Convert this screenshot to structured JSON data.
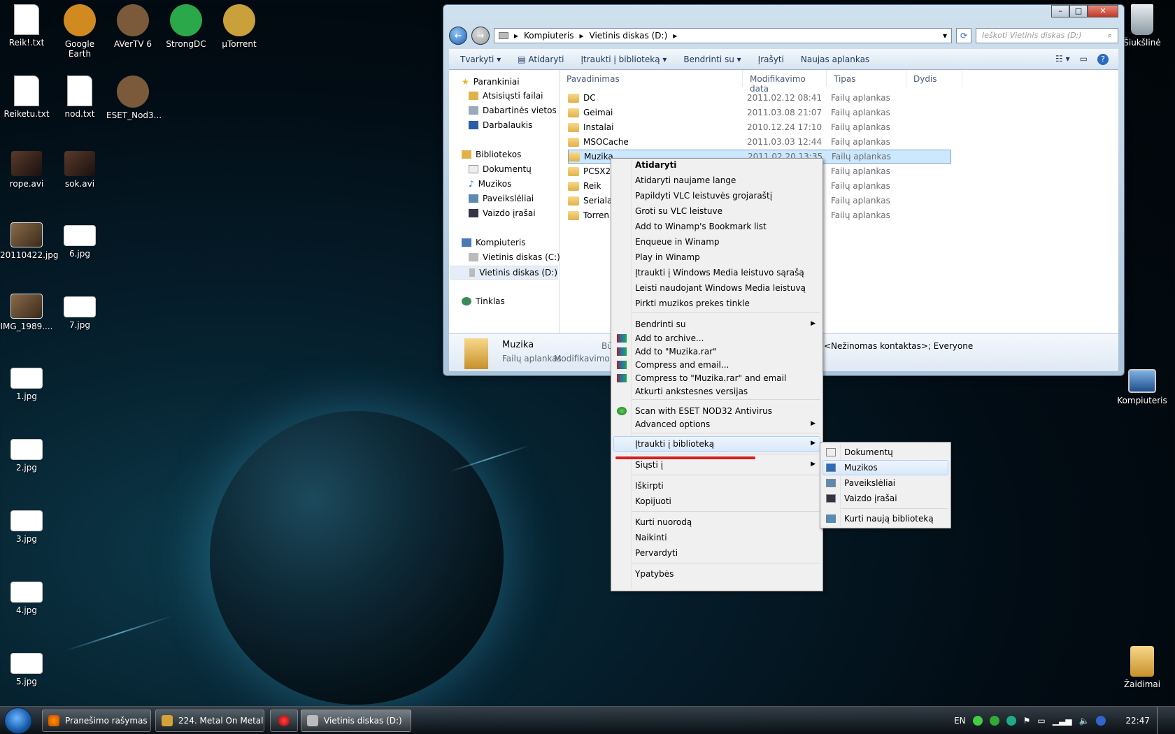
{
  "desktop": {
    "icons": [
      {
        "label": "Reik!.txt",
        "kind": "txt"
      },
      {
        "label": "Google Earth",
        "kind": "app"
      },
      {
        "label": "AVerTV 6",
        "kind": "app"
      },
      {
        "label": "StrongDC",
        "kind": "app"
      },
      {
        "label": "µTorrent",
        "kind": "app"
      },
      {
        "label": "Reiketu.txt",
        "kind": "txt"
      },
      {
        "label": "nod.txt",
        "kind": "txt"
      },
      {
        "label": "ESET_Nod3...",
        "kind": "app"
      },
      {
        "label": "rope.avi",
        "kind": "video"
      },
      {
        "label": "sok.avi",
        "kind": "video"
      },
      {
        "label": "20110422.jpg",
        "kind": "image"
      },
      {
        "label": "6.jpg",
        "kind": "image"
      },
      {
        "label": "IMG_1989....",
        "kind": "image"
      },
      {
        "label": "7.jpg",
        "kind": "image"
      },
      {
        "label": "1.jpg",
        "kind": "image"
      },
      {
        "label": "2.jpg",
        "kind": "image"
      },
      {
        "label": "3.jpg",
        "kind": "image"
      },
      {
        "label": "4.jpg",
        "kind": "image"
      },
      {
        "label": "5.jpg",
        "kind": "image"
      }
    ],
    "right_icons": [
      {
        "label": "Šiukšlinė",
        "icon": "recycle-bin-icon"
      },
      {
        "label": "Kompiuteris",
        "icon": "computer-icon"
      },
      {
        "label": "Žaidimai",
        "icon": "folder-icon"
      }
    ]
  },
  "window": {
    "breadcrumb": [
      "Kompiuteris",
      "Vietinis diskas (D:)"
    ],
    "search_placeholder": "Ieškoti Vietinis diskas (D:)",
    "toolbar": [
      "Tvarkyti",
      "Atidaryti",
      "Įtraukti į biblioteką",
      "Bendrinti su",
      "Įrašyti",
      "Naujas aplankas"
    ],
    "nav": {
      "favorites": "Parankiniai",
      "fav_items": [
        "Atsisiųsti failai",
        "Dabartinės vietos",
        "Darbalaukis"
      ],
      "libraries": "Bibliotekos",
      "lib_items": [
        "Dokumentų",
        "Muzikos",
        "Paveikslėliai",
        "Vaizdo įrašai"
      ],
      "computer": "Kompiuteris",
      "comp_items": [
        "Vietinis diskas (C:)",
        "Vietinis diskas (D:)"
      ],
      "network": "Tinklas"
    },
    "columns": [
      "Pavadinimas",
      "Modifikavimo data",
      "Tipas",
      "Dydis"
    ],
    "files": [
      {
        "name": "DC",
        "date": "2011.02.12 08:41",
        "type": "Failų aplankas"
      },
      {
        "name": "Geimai",
        "date": "2011.03.08 21:07",
        "type": "Failų aplankas"
      },
      {
        "name": "Instalai",
        "date": "2010.12.24 17:10",
        "type": "Failų aplankas"
      },
      {
        "name": "MSOCache",
        "date": "2011.03.03 12:44",
        "type": "Failų aplankas"
      },
      {
        "name": "Muzika",
        "date": "2011.02.20 13:35",
        "type": "Failų aplankas"
      },
      {
        "name": "PCSX2",
        "date": "",
        "type": "Failų aplankas"
      },
      {
        "name": "Reik",
        "date": "",
        "type": "Failų aplankas"
      },
      {
        "name": "Seriala",
        "date": "",
        "type": "Failų aplankas"
      },
      {
        "name": "Torren",
        "date": "",
        "type": "Failų aplankas"
      }
    ],
    "details": {
      "name": "Muzika",
      "type": "Failų aplankas",
      "label2": "Modifikavimo",
      "label1": "Bū",
      "share": "<Nežinomas kontaktas>; Everyone"
    }
  },
  "context_menu": {
    "group1": [
      "Atidaryti",
      "Atidaryti naujame lange",
      "Papildyti VLC leistuvės grojaraštį",
      "Groti su VLC leistuve",
      "Add to Winamp's Bookmark list",
      "Enqueue in Winamp",
      "Play in Winamp",
      "Įtraukti į Windows Media leistuvo sąrašą",
      "Leisti naudojant Windows Media leistuvą",
      "Pirkti muzikos prekes tinkle"
    ],
    "group2": [
      "Bendrinti su",
      "Add to archive...",
      "Add to \"Muzika.rar\"",
      "Compress and email...",
      "Compress to \"Muzika.rar\" and email",
      "Atkurti ankstesnes versijas"
    ],
    "group3": [
      "Scan with ESET NOD32 Antivirus",
      "Advanced options"
    ],
    "group4": [
      "Įtraukti į biblioteką"
    ],
    "group5": [
      "Siųsti į"
    ],
    "group6": [
      "Iškirpti",
      "Kopijuoti"
    ],
    "group7": [
      "Kurti nuorodą",
      "Naikinti",
      "Pervardyti"
    ],
    "group8": [
      "Ypatybės"
    ]
  },
  "submenu": {
    "items": [
      "Dokumentų",
      "Muzikos",
      "Paveikslėliai",
      "Vaizdo įrašai"
    ],
    "create": "Kurti naują biblioteką"
  },
  "taskbar": {
    "items": [
      "Pranešimo rašymas t...",
      "224. Metal On Metal ...",
      "",
      "Vietinis diskas (D:)"
    ],
    "lang": "EN",
    "time": "22:47"
  },
  "colors": {
    "highlight": "#cce8ff",
    "underline": "#d32020",
    "accent": "#1e395b"
  }
}
